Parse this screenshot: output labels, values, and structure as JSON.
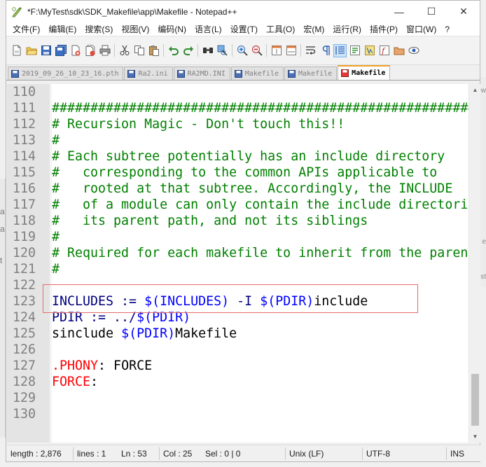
{
  "window": {
    "title": "*F:\\MyTest\\sdk\\SDK_Makefile\\app\\Makefile - Notepad++",
    "controls": {
      "minimize": "—",
      "maximize": "☐",
      "close": "✕"
    }
  },
  "menu": [
    "文件(F)",
    "编辑(E)",
    "搜索(S)",
    "视图(V)",
    "编码(N)",
    "语言(L)",
    "设置(T)",
    "工具(O)",
    "宏(M)",
    "运行(R)",
    "插件(P)",
    "窗口(W)",
    "?"
  ],
  "toolbar_icons": [
    "new-file-icon",
    "open-file-icon",
    "save-icon",
    "save-all-icon",
    "close-icon",
    "close-all-icon",
    "print-icon",
    "cut-icon",
    "copy-icon",
    "paste-icon",
    "undo-icon",
    "redo-icon",
    "find-icon",
    "replace-icon",
    "zoom-in-icon",
    "zoom-out-icon",
    "sync-vertical-icon",
    "sync-horizontal-icon",
    "word-wrap-icon",
    "show-all-chars-icon",
    "indent-guide-icon",
    "udl-icon",
    "doc-map-icon",
    "function-list-icon",
    "folder-workspace-icon",
    "monitoring-icon"
  ],
  "tabs": [
    {
      "label": "2019_09_26_10_23_16.pth",
      "status": "saved",
      "active": false
    },
    {
      "label": "Ra2.ini",
      "status": "saved",
      "active": false
    },
    {
      "label": "RA2MD.INI",
      "status": "saved",
      "active": false
    },
    {
      "label": "Makefile",
      "status": "saved",
      "active": false
    },
    {
      "label": "Makefile",
      "status": "saved",
      "active": false
    },
    {
      "label": "Makefile",
      "status": "modified",
      "active": true
    }
  ],
  "colors": {
    "comment": "#008000",
    "variable": "#000080",
    "dollar": "#0000ff",
    "target": "#ff0000",
    "saved_tab": "#4b6fb5",
    "modified_tab": "#e03a3a",
    "highlight": "#e36a6a"
  },
  "editor": {
    "lines": [
      {
        "n": "110",
        "tokens": []
      },
      {
        "n": "111",
        "tokens": [
          {
            "t": "########################################################",
            "c": "comment"
          }
        ]
      },
      {
        "n": "112",
        "tokens": [
          {
            "t": "# Recursion Magic - Don't touch this!!",
            "c": "comment"
          }
        ]
      },
      {
        "n": "113",
        "tokens": [
          {
            "t": "#",
            "c": "comment"
          }
        ]
      },
      {
        "n": "114",
        "tokens": [
          {
            "t": "# Each subtree potentially has an include directory",
            "c": "comment"
          }
        ]
      },
      {
        "n": "115",
        "tokens": [
          {
            "t": "#   corresponding to the common APIs applicable to",
            "c": "comment"
          }
        ]
      },
      {
        "n": "116",
        "tokens": [
          {
            "t": "#   rooted at that subtree. Accordingly, the INCLUDE",
            "c": "comment"
          }
        ]
      },
      {
        "n": "117",
        "tokens": [
          {
            "t": "#   of a module can only contain the include directories",
            "c": "comment"
          }
        ]
      },
      {
        "n": "118",
        "tokens": [
          {
            "t": "#   its parent path, and not its siblings",
            "c": "comment"
          }
        ]
      },
      {
        "n": "119",
        "tokens": [
          {
            "t": "#",
            "c": "comment"
          }
        ]
      },
      {
        "n": "120",
        "tokens": [
          {
            "t": "# Required for each makefile to inherit from the parent",
            "c": "comment"
          }
        ]
      },
      {
        "n": "121",
        "tokens": [
          {
            "t": "#",
            "c": "comment"
          }
        ]
      },
      {
        "n": "122",
        "tokens": []
      },
      {
        "n": "123",
        "tokens": [
          {
            "t": "INCLUDES := ",
            "c": "var"
          },
          {
            "t": "$(INCLUDES)",
            "c": "dollar"
          },
          {
            "t": " -I ",
            "c": "var"
          },
          {
            "t": "$(PDIR)",
            "c": "dollar"
          },
          {
            "t": "include",
            "c": "default"
          }
        ]
      },
      {
        "n": "124",
        "tokens": [
          {
            "t": "PDIR := ../",
            "c": "var"
          },
          {
            "t": "$(PDIR)",
            "c": "dollar"
          }
        ]
      },
      {
        "n": "125",
        "tokens": [
          {
            "t": "sinclude ",
            "c": "default"
          },
          {
            "t": "$(PDIR)",
            "c": "dollar"
          },
          {
            "t": "Makefile",
            "c": "default"
          }
        ]
      },
      {
        "n": "126",
        "tokens": []
      },
      {
        "n": "127",
        "tokens": [
          {
            "t": ".PHONY",
            "c": "target"
          },
          {
            "t": ": FORCE",
            "c": "default"
          }
        ]
      },
      {
        "n": "128",
        "tokens": [
          {
            "t": "FORCE",
            "c": "target"
          },
          {
            "t": ":",
            "c": "default"
          }
        ]
      },
      {
        "n": "129",
        "tokens": []
      },
      {
        "n": "130",
        "tokens": []
      }
    ]
  },
  "statusbar": {
    "length": "length : 2,876",
    "lines": "lines : 1",
    "ln": "Ln : 53",
    "col": "Col : 25",
    "sel": "Sel : 0 | 0",
    "eol": "Unix (LF)",
    "encoding": "UTF-8",
    "mode": "INS"
  },
  "background_fragments": {
    "left": [
      "a",
      "a",
      "t"
    ],
    "right": [
      "ew",
      "e",
      "st"
    ]
  }
}
